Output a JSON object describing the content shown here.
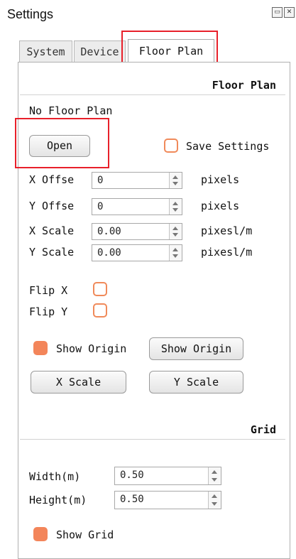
{
  "window": {
    "title": "Settings",
    "float_icon": "restore-icon",
    "close_icon": "close-icon"
  },
  "tabs": [
    {
      "label": "System",
      "active": false
    },
    {
      "label": "Device",
      "active": false
    },
    {
      "label": "Floor Plan",
      "active": true
    }
  ],
  "floor_plan": {
    "section_title": "Floor Plan",
    "status": "No Floor Plan",
    "open_button": "Open",
    "save_settings": {
      "label": "Save Settings",
      "checked": false
    },
    "fields": [
      {
        "label": "X Offse",
        "value": "0",
        "unit": "pixels"
      },
      {
        "label": "Y Offse",
        "value": "0",
        "unit": "pixels"
      },
      {
        "label": "X Scale",
        "value": "0.00",
        "unit": "pixesl/m"
      },
      {
        "label": "Y Scale",
        "value": "0.00",
        "unit": "pixesl/m"
      }
    ],
    "flip_x": {
      "label": "Flip X",
      "checked": false
    },
    "flip_y": {
      "label": "Flip Y",
      "checked": false
    },
    "show_origin_check": {
      "label": "Show Origin",
      "checked": true
    },
    "show_origin_button": "Show Origin",
    "x_scale_button": "X Scale",
    "y_scale_button": "Y Scale"
  },
  "grid": {
    "section_title": "Grid",
    "width": {
      "label": "Width(m)",
      "value": "0.50"
    },
    "height": {
      "label": "Height(m)",
      "value": "0.50"
    },
    "show_grid": {
      "label": "Show Grid",
      "checked": true
    }
  },
  "colors": {
    "accent_checkbox": "#f3855a",
    "highlight": "#e8202a"
  }
}
